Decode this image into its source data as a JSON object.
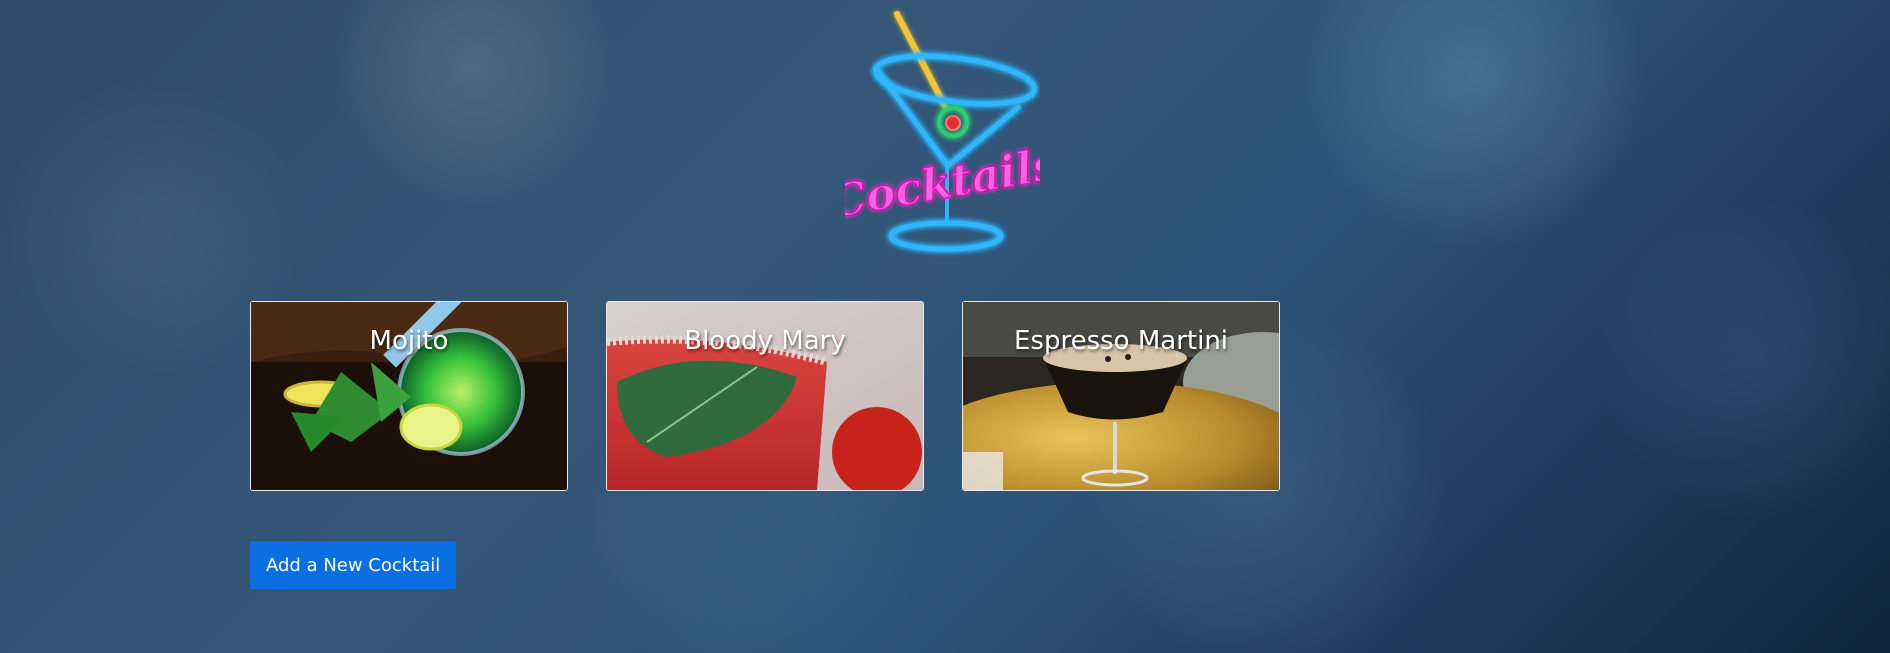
{
  "logo": {
    "text": "Cocktails",
    "icon": "neon-martini-glass-icon",
    "colors": {
      "glass": "#2fb7ff",
      "text": "#ff3bd6",
      "straw": "#f4c531",
      "olive": "#2ecc71"
    }
  },
  "cards": [
    {
      "title": "Mojito"
    },
    {
      "title": "Bloody Mary"
    },
    {
      "title": "Espresso Martini"
    }
  ],
  "actions": {
    "add_label": "Add a New Cocktail"
  },
  "colors": {
    "accent": "#0a6fe3"
  }
}
